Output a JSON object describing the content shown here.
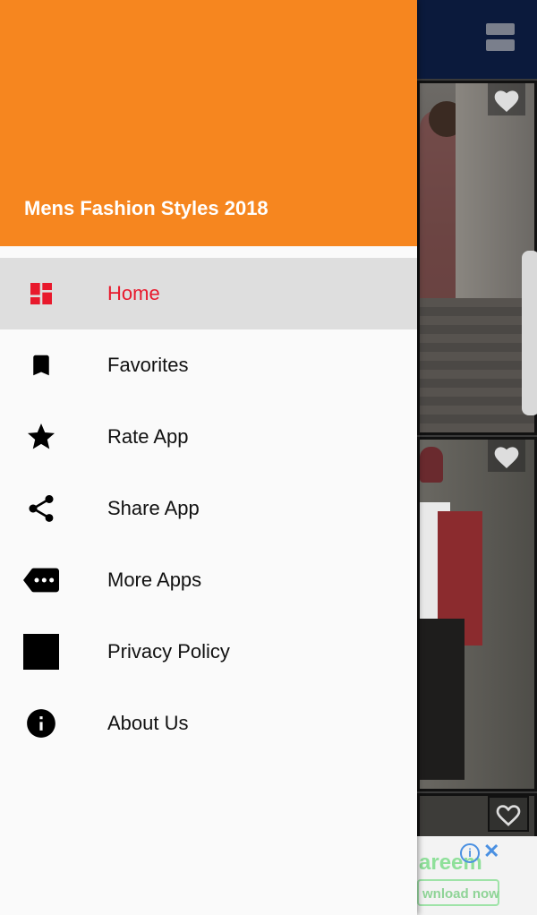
{
  "drawer": {
    "title": "Mens Fashion Styles 2018",
    "items": [
      {
        "label": "Home",
        "icon": "dashboard-icon",
        "active": true
      },
      {
        "label": "Favorites",
        "icon": "bookmark-icon",
        "active": false
      },
      {
        "label": "Rate App",
        "icon": "star-icon",
        "active": false
      },
      {
        "label": "Share App",
        "icon": "share-icon",
        "active": false
      },
      {
        "label": "More Apps",
        "icon": "more-tag-icon",
        "active": false
      },
      {
        "label": "Privacy Policy",
        "icon": "privacy-square-icon",
        "active": false
      },
      {
        "label": "About Us",
        "icon": "info-icon",
        "active": false
      }
    ]
  },
  "ad": {
    "title": "areem",
    "button_label": "wnload now"
  },
  "colors": {
    "header": "#f6861f",
    "active_label": "#e8192c",
    "toolbar": "#0b1a3c"
  }
}
